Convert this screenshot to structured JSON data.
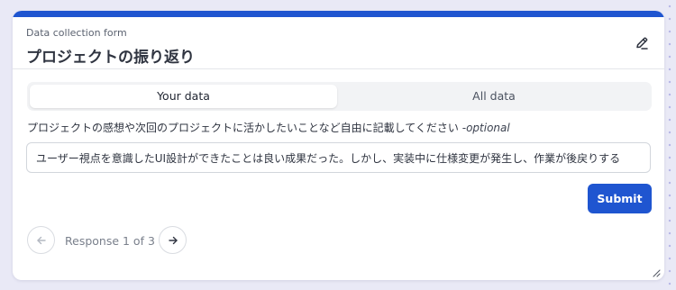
{
  "form": {
    "subtitle": "Data collection form",
    "title": "プロジェクトの振り返り"
  },
  "tabs": [
    {
      "label": "Your data",
      "active": true
    },
    {
      "label": "All data",
      "active": false
    }
  ],
  "question": {
    "text": "プロジェクトの感想や次回のプロジェクトに活かしたいことなど自由に記載してください",
    "optional_label": " -optional"
  },
  "answer": {
    "value": "ユーザー視点を意識したUI設計ができたことは良い成果だった。しかし、実装中に仕様変更が発生し、作業が後戻りする"
  },
  "submit": {
    "label": "Submit"
  },
  "pagination": {
    "label": "Response 1 of 3"
  },
  "colors": {
    "accent": "#1f55d0",
    "background": "#e9e9f6"
  },
  "icons": {
    "edit": "pencil-icon",
    "prev": "arrow-left-icon",
    "next": "arrow-right-icon",
    "resize": "resize-handle-icon"
  }
}
